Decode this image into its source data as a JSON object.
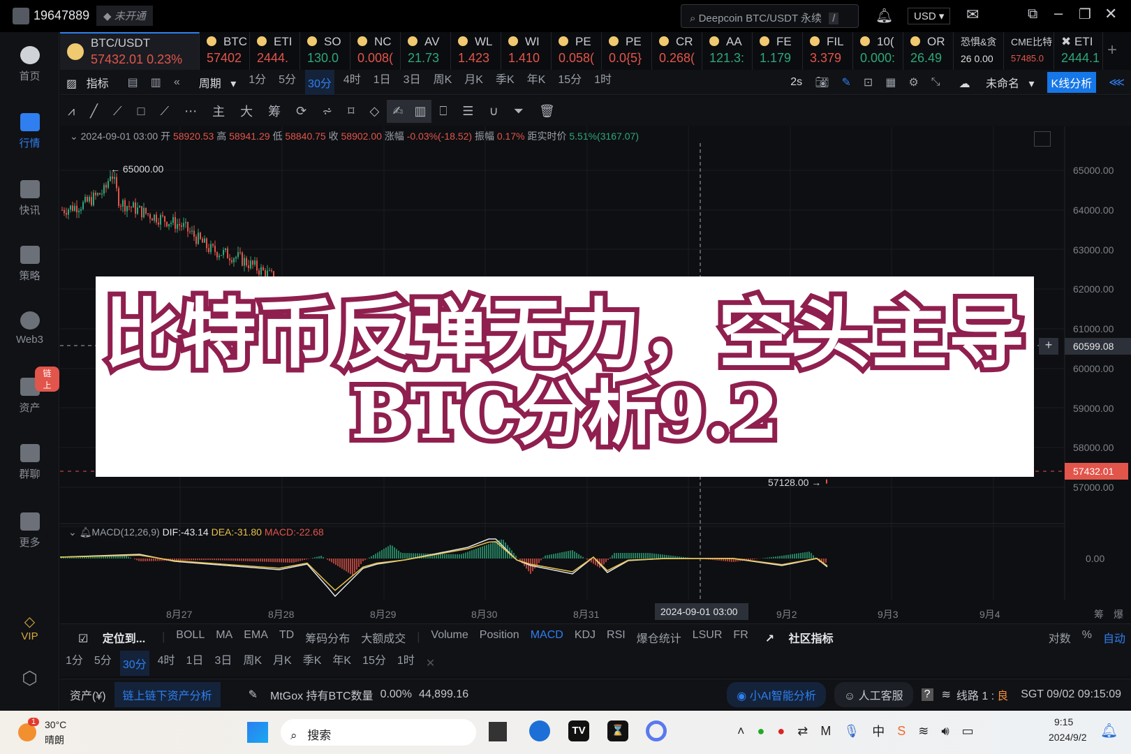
{
  "topbar": {
    "user_id": "19647889",
    "vip_status": "未开通",
    "search_placeholder": "Deepcoin BTC/USDT 永续",
    "search_shortcut": "/",
    "currency": "USD"
  },
  "sidebar": [
    {
      "label": "首页"
    },
    {
      "label": "行情",
      "active": true
    },
    {
      "label": "快讯"
    },
    {
      "label": "策略"
    },
    {
      "label": "Web3"
    },
    {
      "label": "资产",
      "badge": "链上"
    },
    {
      "label": "群聊"
    },
    {
      "label": "更多"
    },
    {
      "label": "VIP"
    }
  ],
  "ticker": {
    "main": {
      "symbol": "BTC/USDT",
      "price": "57432.01",
      "change": "0.23%"
    },
    "items": [
      {
        "name": "BTC",
        "value": "57402",
        "color": "red"
      },
      {
        "name": "ETI",
        "value": "2444.",
        "color": "red"
      },
      {
        "name": "SO",
        "value": "130.0",
        "color": "grn"
      },
      {
        "name": "NC",
        "value": "0.008(",
        "color": "red"
      },
      {
        "name": "AV",
        "value": "21.73",
        "color": "grn"
      },
      {
        "name": "WL",
        "value": "1.423",
        "color": "red"
      },
      {
        "name": "WI",
        "value": "1.410",
        "color": "red"
      },
      {
        "name": "PE",
        "value": "0.058(",
        "color": "red"
      },
      {
        "name": "PE",
        "value": "0.0{5}",
        "color": "red"
      },
      {
        "name": "CR",
        "value": "0.268(",
        "color": "red"
      },
      {
        "name": "AA",
        "value": "121.3:",
        "color": "grn"
      },
      {
        "name": "FE",
        "value": "1.179",
        "color": "grn"
      },
      {
        "name": "FIL",
        "value": "3.379",
        "color": "red"
      },
      {
        "name": "10(",
        "value": "0.000:",
        "color": "grn"
      },
      {
        "name": "OR",
        "value": "26.49",
        "color": "grn"
      }
    ],
    "fear_greed": {
      "name": "恐惧&贪",
      "value": "26 0.00"
    },
    "cme": {
      "name": "CME比特",
      "value": "57485.0"
    },
    "eth": {
      "name": "ETI",
      "value": "2444.1"
    }
  },
  "toolbar": {
    "indicator": "指标",
    "period": "周期",
    "periods": [
      "1分",
      "5分",
      "30分",
      "4时",
      "1日",
      "3日",
      "周K",
      "月K",
      "季K",
      "年K",
      "15分",
      "1时"
    ],
    "active_period": "30分",
    "refresh": "2s",
    "layout_name": "未命名",
    "kline_analysis": "K线分析"
  },
  "drawing_tools": {
    "main": "主",
    "big": "大",
    "chips": "筹"
  },
  "candle_info": {
    "time": "2024-09-01 03:00",
    "open_label": "开",
    "open": "58920.53",
    "high_label": "高",
    "high": "58941.29",
    "low_label": "低",
    "low": "58840.75",
    "close_label": "收",
    "close": "58902.00",
    "change_label": "涨幅",
    "change": "-0.03%(-18.52)",
    "amp_label": "振幅",
    "amp": "0.17%",
    "dist_label": "距实时价",
    "dist": "5.51%(3167.07)"
  },
  "price_axis": [
    "65000.00",
    "64000.00",
    "63000.00",
    "62000.00",
    "61000.00",
    "60000.00",
    "59000.00",
    "58000.00",
    "57000.00"
  ],
  "crosshair_price": "60599.08",
  "last_price": "57432.01",
  "high_marker": "← 65000.00",
  "low_marker": "57128.00 →",
  "macd": {
    "label": "MACD(12,26,9)",
    "dif": "DIF:-43.14",
    "dea": "DEA:-31.80",
    "macd": "MACD:-22.68",
    "zero": "0.00"
  },
  "time_axis": [
    "8月27",
    "8月28",
    "8月29",
    "8月30",
    "8月31",
    "9月2",
    "9月3",
    "9月4"
  ],
  "crosshair_time": "2024-09-01 03:00",
  "axis_right": [
    "筹",
    "爆"
  ],
  "overlay": {
    "line1": "比特币反弹无力，空头主导",
    "line2": "BTC分析9.2"
  },
  "indicators": {
    "locate": "定位到...",
    "main": [
      "BOLL",
      "MA",
      "EMA",
      "TD",
      "筹码分布",
      "大额成交"
    ],
    "sub": [
      "Volume",
      "Position",
      "MACD",
      "KDJ",
      "RSI",
      "爆仓统计",
      "LSUR",
      "FR"
    ],
    "active": "MACD",
    "community": "社区指标",
    "right": [
      "对数",
      "%",
      "自动"
    ]
  },
  "period_row": [
    "1分",
    "5分",
    "30分",
    "4时",
    "1日",
    "3日",
    "周K",
    "月K",
    "季K",
    "年K",
    "15分",
    "1时"
  ],
  "status": {
    "assets": "资产(¥)",
    "onchain": "链上链下资产分析",
    "mtgox": "MtGox 持有BTC数量",
    "pct": "0.00%",
    "amount": "44,899.16",
    "ai": "小AI智能分析",
    "service": "人工客服",
    "line": "线路 1 :",
    "line_quality": "良",
    "time": "SGT 09/02 09:15:09"
  },
  "taskbar": {
    "temp": "30°C",
    "weather": "晴朗",
    "weather_badge": "1",
    "search": "搜索",
    "clock": "9:15",
    "date": "2024/9/2",
    "ime": "中"
  },
  "colors": {
    "up": "#2ea77a",
    "down": "#e2554b",
    "accent": "#2f7ff0",
    "title_stroke": "#8f1f4e"
  }
}
